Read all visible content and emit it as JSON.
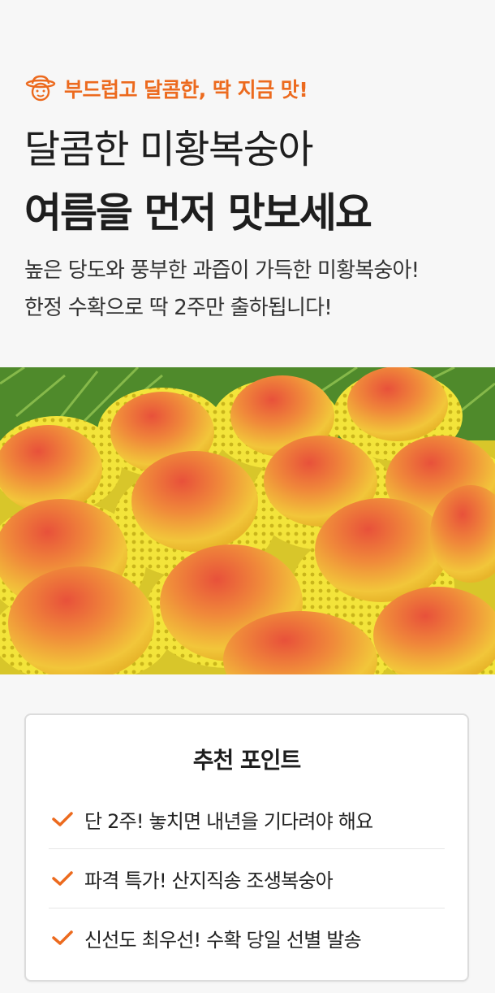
{
  "header": {
    "tagline": "부드럽고 달콤한, 딱 지금 맛!",
    "title_line1": "달콤한 미황복숭아",
    "title_line2": "여름을 먼저 맛보세요",
    "description_lines": [
      "높은 당도와 풍부한 과즙이 가득한 미황복숭아!",
      "한정 수확으로 딱 2주만 출하됩니다!"
    ]
  },
  "photo": {
    "icon": "peach-photo"
  },
  "recommend": {
    "title": "추천 포인트",
    "points": [
      "단 2주! 놓치면 내년을 기다려야 해요",
      "파격 특가! 산지직송 조생복숭아",
      "신선도 최우선! 수확 당일 선별 발송"
    ]
  },
  "colors": {
    "accent": "#ec6a1e",
    "text": "#1e1e1e",
    "background": "#f7f7f7"
  }
}
